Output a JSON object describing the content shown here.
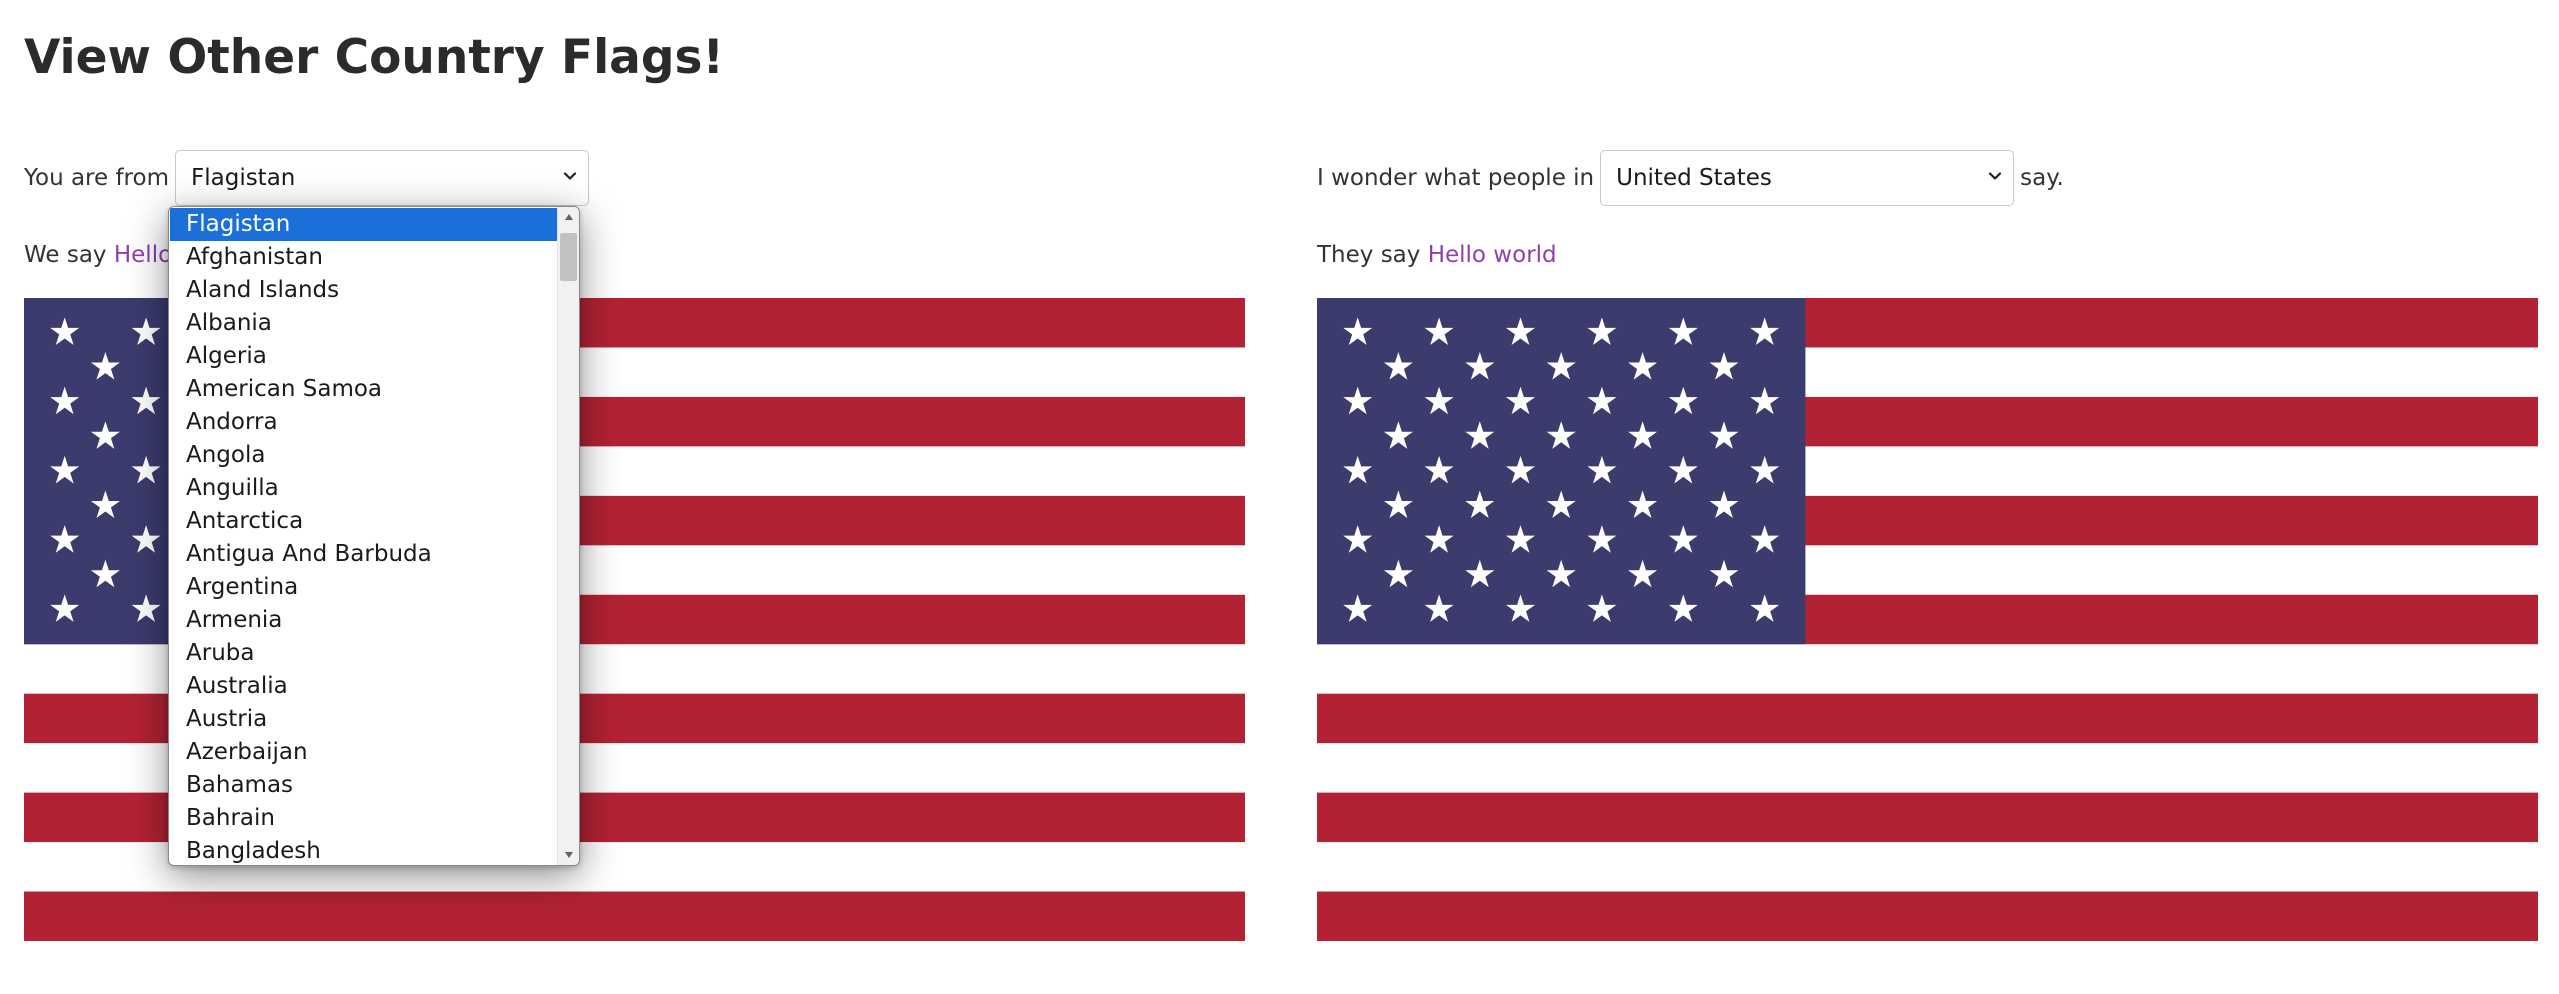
{
  "page": {
    "title": "View Other Country Flags!"
  },
  "left": {
    "prefix": "You are from",
    "selected_country": "Flagistan",
    "say_prefix": "We say",
    "greeting": "Hello"
  },
  "right": {
    "prefix": "I wonder what people in",
    "selected_country": "United States",
    "suffix": "say.",
    "say_prefix": "They say",
    "greeting": "Hello world"
  },
  "dropdown": {
    "options": [
      "Flagistan",
      "Afghanistan",
      "Aland Islands",
      "Albania",
      "Algeria",
      "American Samoa",
      "Andorra",
      "Angola",
      "Anguilla",
      "Antarctica",
      "Antigua And Barbuda",
      "Argentina",
      "Armenia",
      "Aruba",
      "Australia",
      "Austria",
      "Azerbaijan",
      "Bahamas",
      "Bahrain",
      "Bangladesh"
    ],
    "selected_index": 0
  },
  "colors": {
    "flag_red": "#b22234",
    "flag_white": "#ffffff",
    "flag_blue": "#3c3b6e",
    "greeting_link": "#8e3fb0",
    "selected_option_bg": "#1a6fd8"
  },
  "icons": {
    "select_chevron": "chevron-down-icon",
    "scroll_up": "triangle-up-icon",
    "scroll_down": "triangle-down-icon"
  }
}
